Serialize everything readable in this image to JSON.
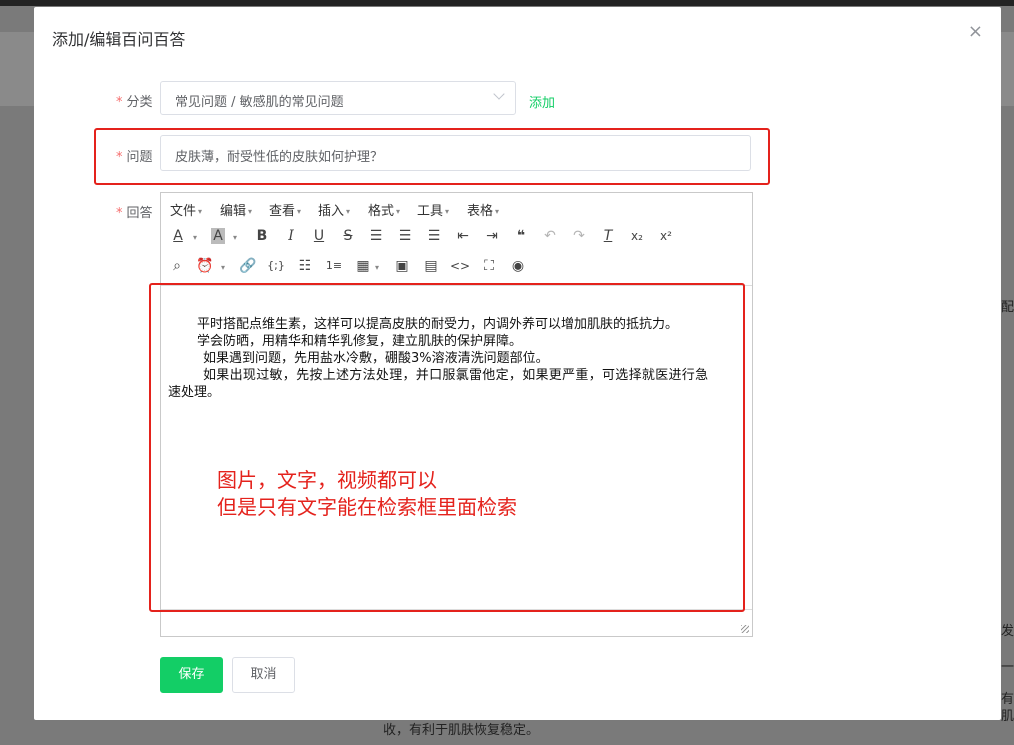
{
  "background": {
    "bottom_text": "收，有利于肌肤恢复稳定。",
    "right_fragments": [
      "配",
      "发",
      "一",
      "有",
      "肌"
    ]
  },
  "dialog": {
    "title": "添加/编辑百问百答",
    "close": "×"
  },
  "form": {
    "category": {
      "label": "分类",
      "value": "常见问题 / 敏感肌的常见问题",
      "add_link": "添加"
    },
    "question": {
      "label": "问题",
      "value": "皮肤薄，耐受性低的皮肤如何护理？"
    },
    "answer": {
      "label": "回答"
    },
    "required_mark": "*"
  },
  "editor": {
    "menus": [
      "文件",
      "编辑",
      "查看",
      "插入",
      "格式",
      "工具",
      "表格"
    ],
    "content_lines": [
      "平时搭配点维生素，这样可以提高皮肤的耐受力，内调外养可以增加肌肤的抵抗力。",
      "学会防晒，用精华和精华乳修复，建立肌肤的保护屏障。",
      "如果遇到问题，先用盐水冷敷，硼酸3%溶液清洗问题部位。",
      "如果出现过敏，先按上述方法处理，并口服氯雷他定，如果更严重，可选择就医进行急",
      "速处理。"
    ]
  },
  "annotation": {
    "line1": "图片，文字，视频都可以",
    "line2": "但是只有文字能在检索框里面检索",
    "color": "#e4221c"
  },
  "buttons": {
    "save": "保存",
    "cancel": "取消"
  },
  "colors": {
    "accent": "#13ce66",
    "required": "#f56c6c",
    "highlight": "#e4221c"
  }
}
